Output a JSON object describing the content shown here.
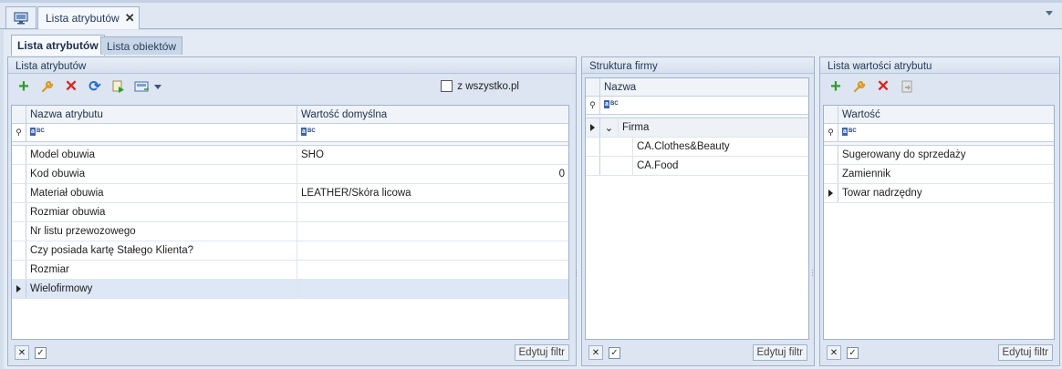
{
  "window": {
    "doc_tab_label": "Lista atrybutów",
    "doc_tab_close": "✕"
  },
  "subtabs": {
    "active": "Lista atrybutów",
    "inactive": "Lista obiektów"
  },
  "attributes_panel": {
    "title": "Lista atrybutów",
    "checkbox_label": "z wszystko.pl",
    "checkbox_checked": false,
    "columns": [
      "Nazwa atrybutu",
      "Wartość domyślna"
    ],
    "rows": [
      {
        "name": "Model obuwia",
        "value": "SHO"
      },
      {
        "name": "Kod obuwia",
        "value": "0"
      },
      {
        "name": "Materiał obuwia",
        "value": "LEATHER/Skóra licowa"
      },
      {
        "name": "Rozmiar obuwia",
        "value": ""
      },
      {
        "name": "Nr listu przewozowego",
        "value": ""
      },
      {
        "name": "Czy posiada kartę Stałego Klienta?",
        "value": ""
      },
      {
        "name": "Rozmiar",
        "value": ""
      },
      {
        "name": "Wielofirmowy",
        "value": ""
      }
    ],
    "selected_row": 7,
    "edit_filter_label": "Edytuj filtr"
  },
  "structure_panel": {
    "title": "Struktura firmy",
    "column": "Nazwa",
    "root": "Firma",
    "children": [
      "CA.Clothes&Beauty",
      "CA.Food"
    ],
    "edit_filter_label": "Edytuj filtr"
  },
  "values_panel": {
    "title": "Lista wartości atrybutu",
    "column": "Wartość",
    "rows": [
      "Sugerowany do sprzedaży",
      "Zamiennik",
      "Towar nadrzędny"
    ],
    "selected_row": 2,
    "edit_filter_label": "Edytuj filtr"
  },
  "filter_glyph": "BC",
  "colors": {
    "add": "#2e9c2e",
    "delete": "#d9261c",
    "edit": "#e0a12a",
    "refresh": "#2a6fc4"
  }
}
